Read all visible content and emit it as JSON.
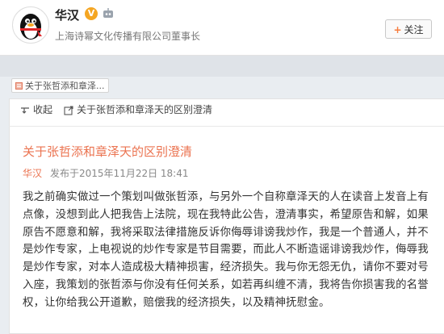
{
  "profile": {
    "name": "华汉",
    "verified_badge": "V",
    "bio": "上海诗幂文化传播有限公司董事长",
    "follow_label": "关注",
    "follow_plus": "+"
  },
  "breadcrumb": {
    "label": "关于张哲添和章泽..."
  },
  "actions": {
    "collapse_label": "收起",
    "article_link_label": "关于张哲添和章泽天的区别澄清"
  },
  "article": {
    "title": "关于张哲添和章泽天的区别澄清",
    "author": "华汉",
    "published": "发布于2015年11月22日 18:41",
    "body": "我之前确实做过一个策划叫做张哲添，与另外一个自称章泽天的人在读音上发音上有点像，没想到此人把我告上法院，现在我特此公告，澄清事实，希望原告和解，如果原告不愿意和解，我将采取法律措施反诉你侮辱诽谤我炒作，我是一个普通人，并不是炒作专家，上电视说的炒作专家是节目需要，而此人不断造谣诽谤我炒作，侮辱我是炒作专家，对本人造成极大精神损害，经济损失。我与你无怨无仇，请你不要对号入座，我策划的张哲添与你没有任何关系，如若再纠缠不清，我将告你损害我的名誉权，让你给我公开道歉，赔偿我的经济损失，以及精神抚慰金。"
  },
  "icons": [
    "penguin-avatar",
    "verified-icon",
    "robot-icon",
    "note-icon",
    "collapse-icon",
    "external-link-icon"
  ],
  "colors": {
    "accent": "#eb7350",
    "badge": "#f5a623",
    "background": "#e9edf1"
  }
}
